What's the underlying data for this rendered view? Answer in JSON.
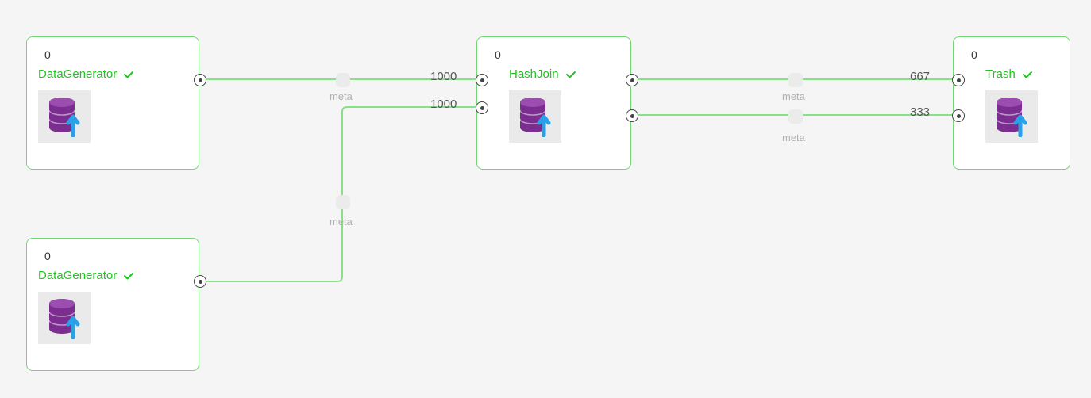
{
  "nodes": {
    "n1": {
      "title": "DataGenerator",
      "badge": "0"
    },
    "n2": {
      "title": "DataGenerator",
      "badge": "0"
    },
    "n3": {
      "title": "HashJoin",
      "badge": "0"
    },
    "n4": {
      "title": "Trash",
      "badge": "0"
    }
  },
  "edges": {
    "e1": {
      "count": "1000",
      "label": "meta"
    },
    "e2": {
      "count": "1000",
      "label": "meta"
    },
    "e3": {
      "count": "667",
      "label": "meta"
    },
    "e4": {
      "count": "333",
      "label": "meta"
    }
  }
}
